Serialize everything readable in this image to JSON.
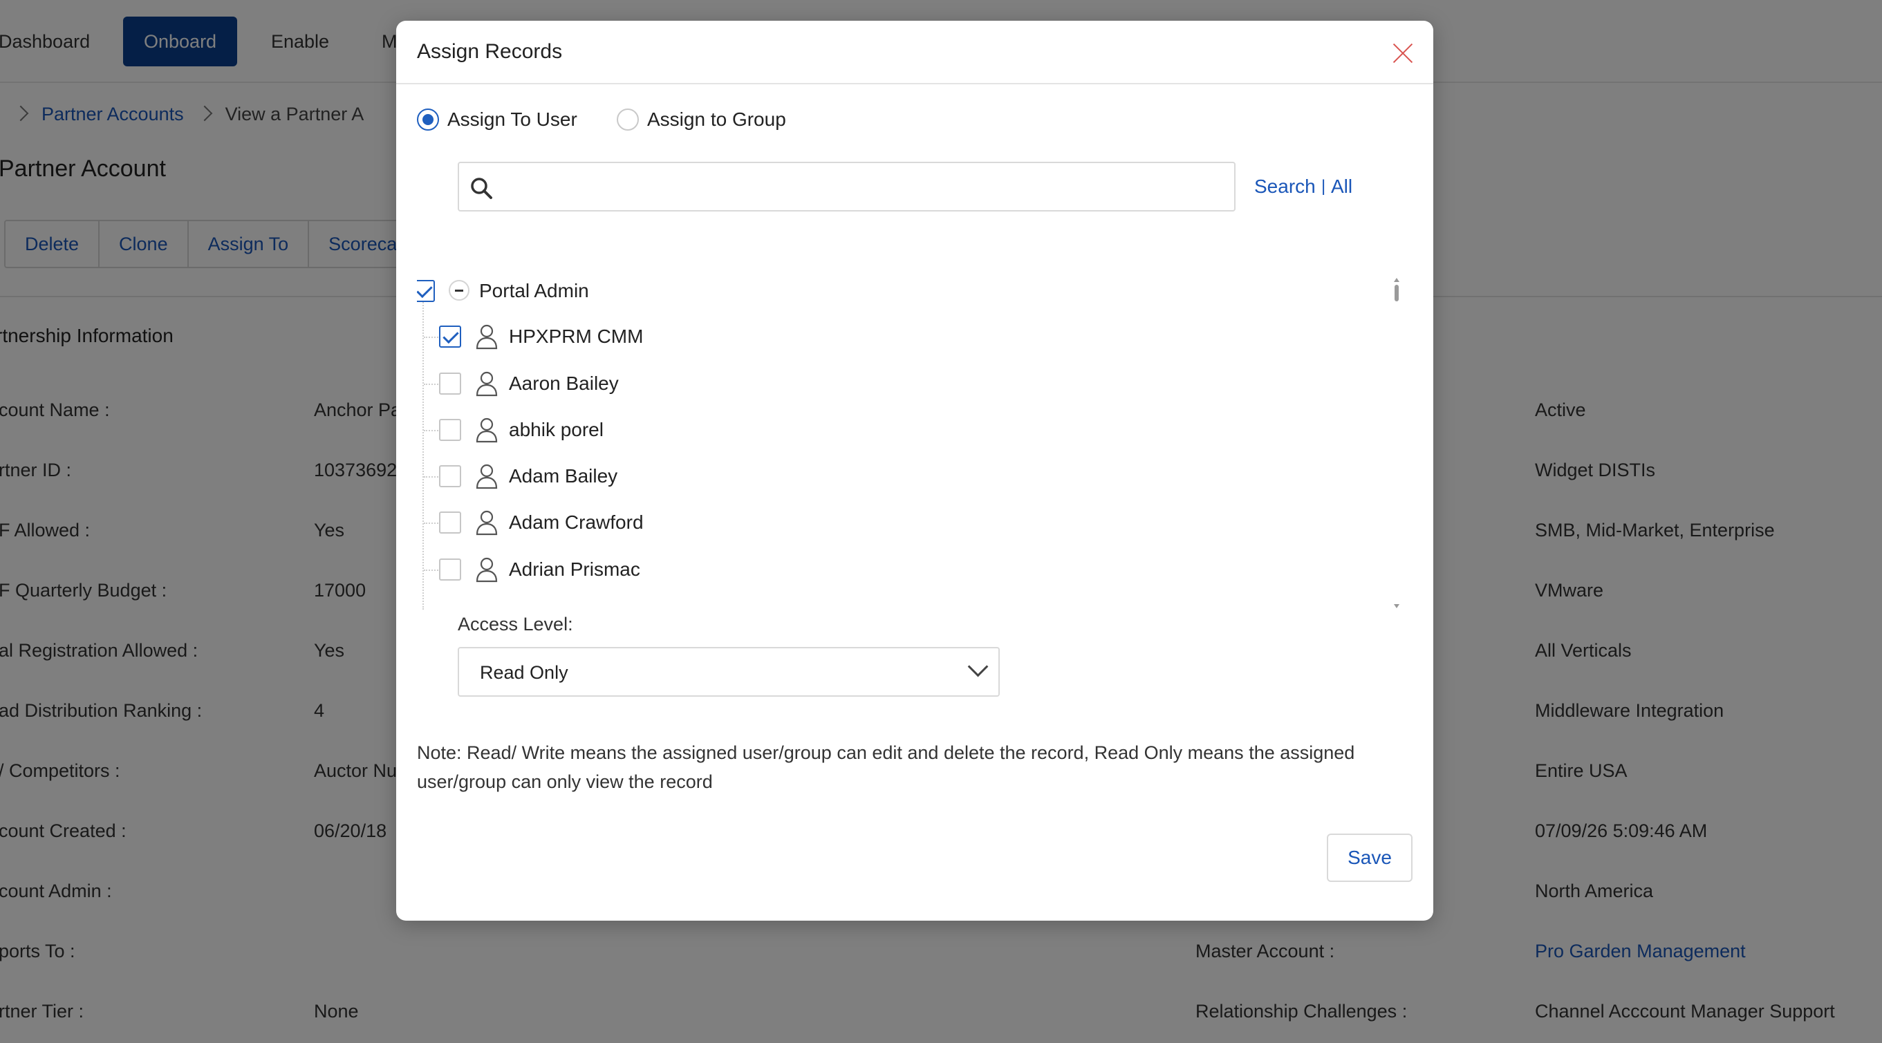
{
  "nav": {
    "items": [
      "Dashboard",
      "Onboard",
      "Enable",
      "M"
    ],
    "active": "Onboard"
  },
  "breadcrumb": {
    "link": "Partner Accounts",
    "current": "View a Partner A"
  },
  "page": {
    "title": "Partner Account",
    "actions": [
      "Delete",
      "Clone",
      "Assign To",
      "Scoreca"
    ],
    "section_title": "rtnership Information"
  },
  "left_fields": [
    {
      "label": "count Name :",
      "value": "Anchor Pa"
    },
    {
      "label": "rtner ID :",
      "value": "10373692"
    },
    {
      "label": "F Allowed :",
      "value": "Yes"
    },
    {
      "label": "F Quarterly Budget :",
      "value": "17000"
    },
    {
      "label": "al Registration Allowed :",
      "value": "Yes"
    },
    {
      "label": "ad Distribution Ranking :",
      "value": "4"
    },
    {
      "label": "/ Competitors :",
      "value": "Auctor Nu"
    },
    {
      "label": "count Created :",
      "value": "06/20/18"
    },
    {
      "label": "count Admin :",
      "value": ""
    },
    {
      "label": "ports To :",
      "value": ""
    },
    {
      "label": "rtner Tier :",
      "value": "None"
    }
  ],
  "right_fields": [
    {
      "label": "",
      "value": "Active"
    },
    {
      "label": "",
      "value": "Widget DISTIs"
    },
    {
      "label": "",
      "value": "SMB, Mid-Market, Enterprise"
    },
    {
      "label": "",
      "value": "VMware"
    },
    {
      "label": "",
      "value": "All Verticals"
    },
    {
      "label": "",
      "value": "Middleware Integration"
    },
    {
      "label": "",
      "value": "Entire USA"
    },
    {
      "label": "",
      "value": "07/09/26 5:09:46 AM"
    },
    {
      "label": "",
      "value": "North America"
    },
    {
      "label": "Master Account :",
      "value": "Pro Garden Management"
    },
    {
      "label": "Relationship Challenges :",
      "value": "Channel Acccount Manager Support"
    }
  ],
  "modal": {
    "title": "Assign Records",
    "assign_options": [
      {
        "label": "Assign To User",
        "selected": true
      },
      {
        "label": "Assign to Group",
        "selected": false
      }
    ],
    "search": {
      "value": "",
      "placeholder": "",
      "search_label": "Search",
      "separator": "|",
      "all_label": "All"
    },
    "tree": {
      "group": {
        "label": "Portal Admin",
        "checked": true
      },
      "users": [
        {
          "name": "HPXPRM CMM",
          "checked": true
        },
        {
          "name": "Aaron Bailey",
          "checked": false
        },
        {
          "name": "abhik porel",
          "checked": false
        },
        {
          "name": "Adam Bailey",
          "checked": false
        },
        {
          "name": "Adam Crawford",
          "checked": false
        },
        {
          "name": "Adrian Prismac",
          "checked": false
        }
      ]
    },
    "access_level": {
      "label": "Access Level:",
      "value": "Read Only"
    },
    "note": "Note: Read/ Write means the assigned user/group can edit and delete the record, Read Only means the assigned user/group can only view the record",
    "save_label": "Save"
  },
  "colors": {
    "nav_active_bg": "#0b3f8f",
    "link": "#1a56b8",
    "radio_checked": "#1f5fbf",
    "close_icon": "#d9534f",
    "overlay": "rgba(0,0,0,0.5)"
  }
}
